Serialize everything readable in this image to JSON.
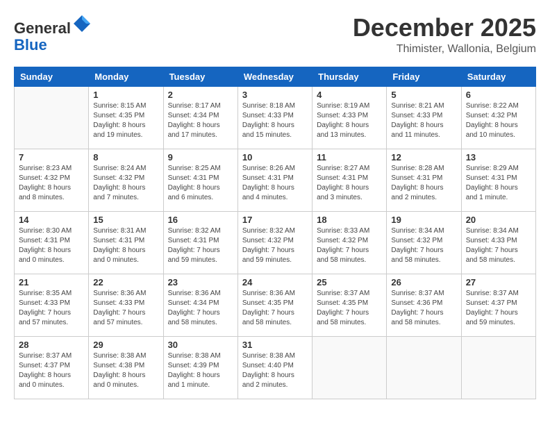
{
  "logo": {
    "general": "General",
    "blue": "Blue"
  },
  "header": {
    "month": "December 2025",
    "location": "Thimister, Wallonia, Belgium"
  },
  "days_of_week": [
    "Sunday",
    "Monday",
    "Tuesday",
    "Wednesday",
    "Thursday",
    "Friday",
    "Saturday"
  ],
  "weeks": [
    [
      {
        "day": "",
        "info": ""
      },
      {
        "day": "1",
        "info": "Sunrise: 8:15 AM\nSunset: 4:35 PM\nDaylight: 8 hours\nand 19 minutes."
      },
      {
        "day": "2",
        "info": "Sunrise: 8:17 AM\nSunset: 4:34 PM\nDaylight: 8 hours\nand 17 minutes."
      },
      {
        "day": "3",
        "info": "Sunrise: 8:18 AM\nSunset: 4:33 PM\nDaylight: 8 hours\nand 15 minutes."
      },
      {
        "day": "4",
        "info": "Sunrise: 8:19 AM\nSunset: 4:33 PM\nDaylight: 8 hours\nand 13 minutes."
      },
      {
        "day": "5",
        "info": "Sunrise: 8:21 AM\nSunset: 4:33 PM\nDaylight: 8 hours\nand 11 minutes."
      },
      {
        "day": "6",
        "info": "Sunrise: 8:22 AM\nSunset: 4:32 PM\nDaylight: 8 hours\nand 10 minutes."
      }
    ],
    [
      {
        "day": "7",
        "info": "Sunrise: 8:23 AM\nSunset: 4:32 PM\nDaylight: 8 hours\nand 8 minutes."
      },
      {
        "day": "8",
        "info": "Sunrise: 8:24 AM\nSunset: 4:32 PM\nDaylight: 8 hours\nand 7 minutes."
      },
      {
        "day": "9",
        "info": "Sunrise: 8:25 AM\nSunset: 4:31 PM\nDaylight: 8 hours\nand 6 minutes."
      },
      {
        "day": "10",
        "info": "Sunrise: 8:26 AM\nSunset: 4:31 PM\nDaylight: 8 hours\nand 4 minutes."
      },
      {
        "day": "11",
        "info": "Sunrise: 8:27 AM\nSunset: 4:31 PM\nDaylight: 8 hours\nand 3 minutes."
      },
      {
        "day": "12",
        "info": "Sunrise: 8:28 AM\nSunset: 4:31 PM\nDaylight: 8 hours\nand 2 minutes."
      },
      {
        "day": "13",
        "info": "Sunrise: 8:29 AM\nSunset: 4:31 PM\nDaylight: 8 hours\nand 1 minute."
      }
    ],
    [
      {
        "day": "14",
        "info": "Sunrise: 8:30 AM\nSunset: 4:31 PM\nDaylight: 8 hours\nand 0 minutes."
      },
      {
        "day": "15",
        "info": "Sunrise: 8:31 AM\nSunset: 4:31 PM\nDaylight: 8 hours\nand 0 minutes."
      },
      {
        "day": "16",
        "info": "Sunrise: 8:32 AM\nSunset: 4:31 PM\nDaylight: 7 hours\nand 59 minutes."
      },
      {
        "day": "17",
        "info": "Sunrise: 8:32 AM\nSunset: 4:32 PM\nDaylight: 7 hours\nand 59 minutes."
      },
      {
        "day": "18",
        "info": "Sunrise: 8:33 AM\nSunset: 4:32 PM\nDaylight: 7 hours\nand 58 minutes."
      },
      {
        "day": "19",
        "info": "Sunrise: 8:34 AM\nSunset: 4:32 PM\nDaylight: 7 hours\nand 58 minutes."
      },
      {
        "day": "20",
        "info": "Sunrise: 8:34 AM\nSunset: 4:33 PM\nDaylight: 7 hours\nand 58 minutes."
      }
    ],
    [
      {
        "day": "21",
        "info": "Sunrise: 8:35 AM\nSunset: 4:33 PM\nDaylight: 7 hours\nand 57 minutes."
      },
      {
        "day": "22",
        "info": "Sunrise: 8:36 AM\nSunset: 4:33 PM\nDaylight: 7 hours\nand 57 minutes."
      },
      {
        "day": "23",
        "info": "Sunrise: 8:36 AM\nSunset: 4:34 PM\nDaylight: 7 hours\nand 58 minutes."
      },
      {
        "day": "24",
        "info": "Sunrise: 8:36 AM\nSunset: 4:35 PM\nDaylight: 7 hours\nand 58 minutes."
      },
      {
        "day": "25",
        "info": "Sunrise: 8:37 AM\nSunset: 4:35 PM\nDaylight: 7 hours\nand 58 minutes."
      },
      {
        "day": "26",
        "info": "Sunrise: 8:37 AM\nSunset: 4:36 PM\nDaylight: 7 hours\nand 58 minutes."
      },
      {
        "day": "27",
        "info": "Sunrise: 8:37 AM\nSunset: 4:37 PM\nDaylight: 7 hours\nand 59 minutes."
      }
    ],
    [
      {
        "day": "28",
        "info": "Sunrise: 8:37 AM\nSunset: 4:37 PM\nDaylight: 8 hours\nand 0 minutes."
      },
      {
        "day": "29",
        "info": "Sunrise: 8:38 AM\nSunset: 4:38 PM\nDaylight: 8 hours\nand 0 minutes."
      },
      {
        "day": "30",
        "info": "Sunrise: 8:38 AM\nSunset: 4:39 PM\nDaylight: 8 hours\nand 1 minute."
      },
      {
        "day": "31",
        "info": "Sunrise: 8:38 AM\nSunset: 4:40 PM\nDaylight: 8 hours\nand 2 minutes."
      },
      {
        "day": "",
        "info": ""
      },
      {
        "day": "",
        "info": ""
      },
      {
        "day": "",
        "info": ""
      }
    ]
  ]
}
